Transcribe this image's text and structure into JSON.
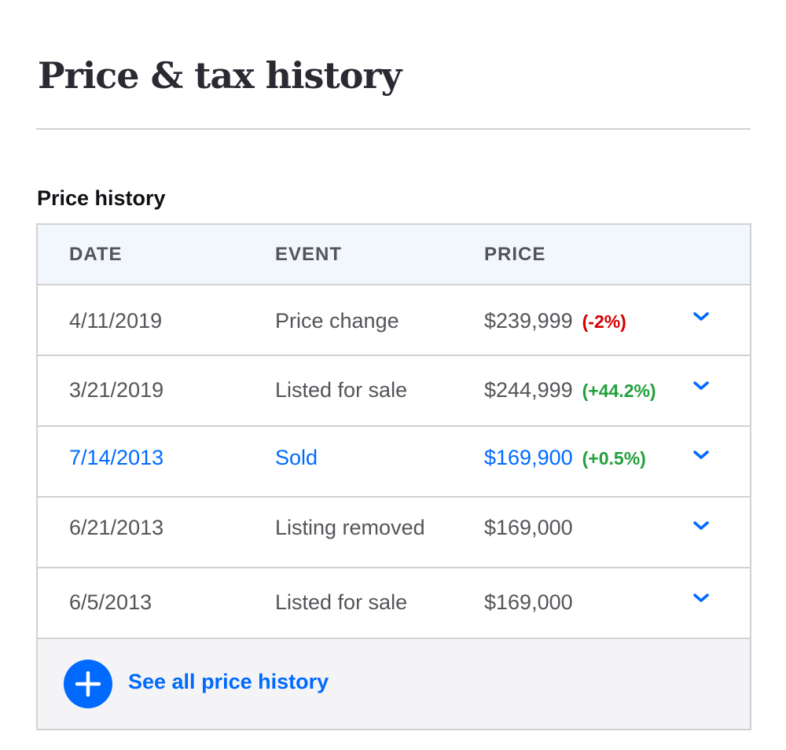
{
  "section": {
    "title": "Price & tax history",
    "subtitle": "Price history"
  },
  "table": {
    "headers": {
      "date": "DATE",
      "event": "EVENT",
      "price": "PRICE"
    },
    "rows": [
      {
        "date": "4/11/2019",
        "event": "Price change",
        "price": "$239,999",
        "change": "(-2%)",
        "change_type": "negative",
        "highlighted": false
      },
      {
        "date": "3/21/2019",
        "event": "Listed for sale",
        "price": "$244,999",
        "change": "(+44.2%)",
        "change_type": "positive",
        "highlighted": false
      },
      {
        "date": "7/14/2013",
        "event": "Sold",
        "price": "$169,900",
        "change": "(+0.5%)",
        "change_type": "positive",
        "highlighted": true
      },
      {
        "date": "6/21/2013",
        "event": "Listing removed",
        "price": "$169,000",
        "change": "",
        "change_type": "none",
        "highlighted": false
      },
      {
        "date": "6/5/2013",
        "event": "Listed for sale",
        "price": "$169,000",
        "change": "",
        "change_type": "none",
        "highlighted": false
      }
    ],
    "row_expand_icon": "chevron-down-icon"
  },
  "footer": {
    "see_all_label": "See all price history",
    "icon": "plus-icon"
  },
  "colors": {
    "accent": "#006aff",
    "negative": "#d40000",
    "positive": "#22a03c",
    "header_bg": "#f2f6fd",
    "footer_bg": "#f4f4f6"
  }
}
